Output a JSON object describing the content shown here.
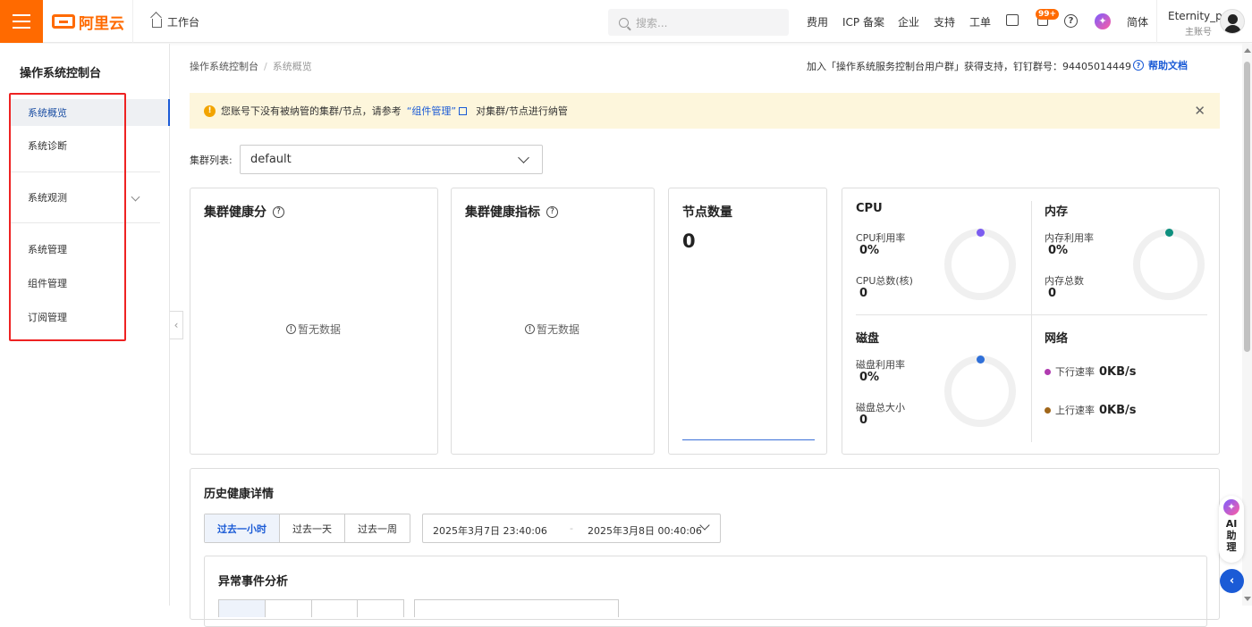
{
  "topbar": {
    "logo_text": "阿里云",
    "workbench": "工作台",
    "search_placeholder": "搜索...",
    "nav": [
      "费用",
      "ICP 备案",
      "企业",
      "支持",
      "工单"
    ],
    "notification_badge": "99+",
    "language": "简体",
    "user_name": "Eternity_p",
    "user_role": "主账号",
    "accent_color": "#ff6a00"
  },
  "sidebar": {
    "title": "操作系统控制台",
    "items": [
      {
        "label": "系统概览",
        "active": true
      },
      {
        "label": "系统诊断"
      },
      {
        "label": "系统观测",
        "expandable": true
      },
      {
        "label": "系统管理"
      },
      {
        "label": "组件管理"
      },
      {
        "label": "订阅管理"
      }
    ]
  },
  "header": {
    "breadcrumb": [
      "操作系统控制台",
      "系统概览"
    ],
    "support_text": "加入「操作系统服务控制台用户群」获得支持，钉钉群号：94405014449",
    "help_doc": "帮助文档"
  },
  "alert": {
    "prefix": "您账号下没有被纳管的集群/节点，请参考",
    "link": "“组件管理”",
    "suffix": "对集群/节点进行纳管"
  },
  "cluster": {
    "label": "集群列表:",
    "selected": "default"
  },
  "cards": {
    "health_score": {
      "title": "集群健康分",
      "empty": "暂无数据"
    },
    "health_metrics": {
      "title": "集群健康指标",
      "empty": "暂无数据"
    },
    "node_count": {
      "title": "节点数量",
      "value": "0"
    }
  },
  "metrics": {
    "cpu": {
      "title": "CPU",
      "usage_label": "CPU利用率",
      "usage_value": "0%",
      "total_label": "CPU总数(核)",
      "total_value": "0",
      "color": "#7b5cf0"
    },
    "memory": {
      "title": "内存",
      "usage_label": "内存利用率",
      "usage_value": "0%",
      "total_label": "内存总数",
      "total_value": "0",
      "color": "#0e8f7e"
    },
    "disk": {
      "title": "磁盘",
      "usage_label": "磁盘利用率",
      "usage_value": "0%",
      "total_label": "磁盘总大小",
      "total_value": "0",
      "color": "#2f6fd8"
    },
    "network": {
      "title": "网络",
      "down_label": "下行速率",
      "down_value": "0KB/s",
      "up_label": "上行速率",
      "up_value": "0KB/s",
      "down_color": "#b03bb0",
      "up_color": "#a0661a"
    }
  },
  "history": {
    "title": "历史健康详情",
    "ranges": [
      "过去一小时",
      "过去一天",
      "过去一周"
    ],
    "start": "2025年3月7日 23:40:06",
    "separator": "-",
    "end": "2025年3月8日 00:40:06",
    "anomaly_title": "异常事件分析"
  },
  "ai": {
    "label": "AI助理"
  }
}
